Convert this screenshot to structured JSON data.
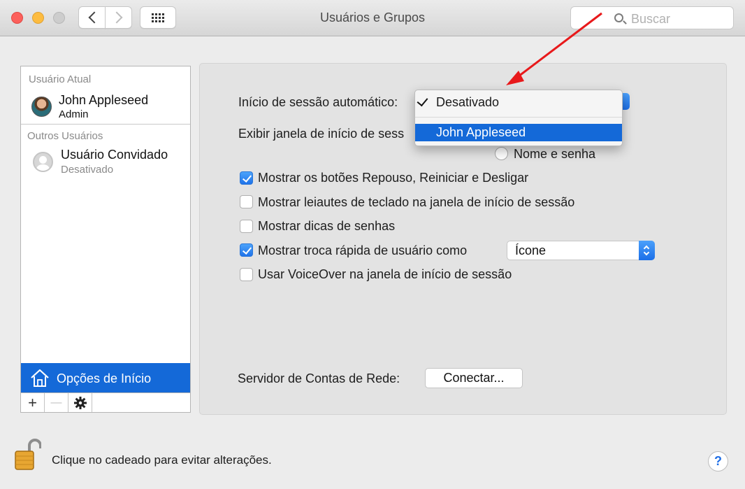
{
  "window": {
    "title": "Usuários e Grupos"
  },
  "search": {
    "placeholder": "Buscar"
  },
  "sidebar": {
    "current_user_header": "Usuário Atual",
    "current_user": {
      "name": "John Appleseed",
      "role": "Admin"
    },
    "other_users_header": "Outros Usuários",
    "guest_user": {
      "name": "Usuário Convidado",
      "status": "Desativado"
    },
    "login_options_label": "Opções de Início",
    "toolbar": {
      "add": "+",
      "remove": "—"
    }
  },
  "panel": {
    "auto_login_label": "Início de sessão automático:",
    "display_login_window_label": "Exibir janela de início de sess",
    "name_password_option": "Nome e senha",
    "checkboxes": [
      {
        "label": "Mostrar os botões Repouso, Reiniciar e Desligar",
        "checked": true
      },
      {
        "label": "Mostrar leiautes de teclado na janela de início de sessão",
        "checked": false
      },
      {
        "label": "Mostrar dicas de senhas",
        "checked": false
      },
      {
        "label": "Mostrar troca rápida de usuário como",
        "checked": true
      },
      {
        "label": "Usar VoiceOver na janela de início de sessão",
        "checked": false
      }
    ],
    "fast_switch_select_value": "Ícone",
    "network_server_label": "Servidor de Contas de Rede:",
    "connect_button": "Conectar..."
  },
  "dropdown": {
    "items": [
      {
        "label": "Desativado",
        "checked": true
      },
      {
        "label": "John Appleseed",
        "highlighted": true
      }
    ]
  },
  "footer": {
    "lock_text": "Clique no cadeado para evitar alterações.",
    "help_label": "?"
  },
  "colors": {
    "accent": "#1469d8",
    "annotation_arrow": "#e8191b",
    "close": "#fc605c",
    "minimize": "#fdbc40"
  }
}
